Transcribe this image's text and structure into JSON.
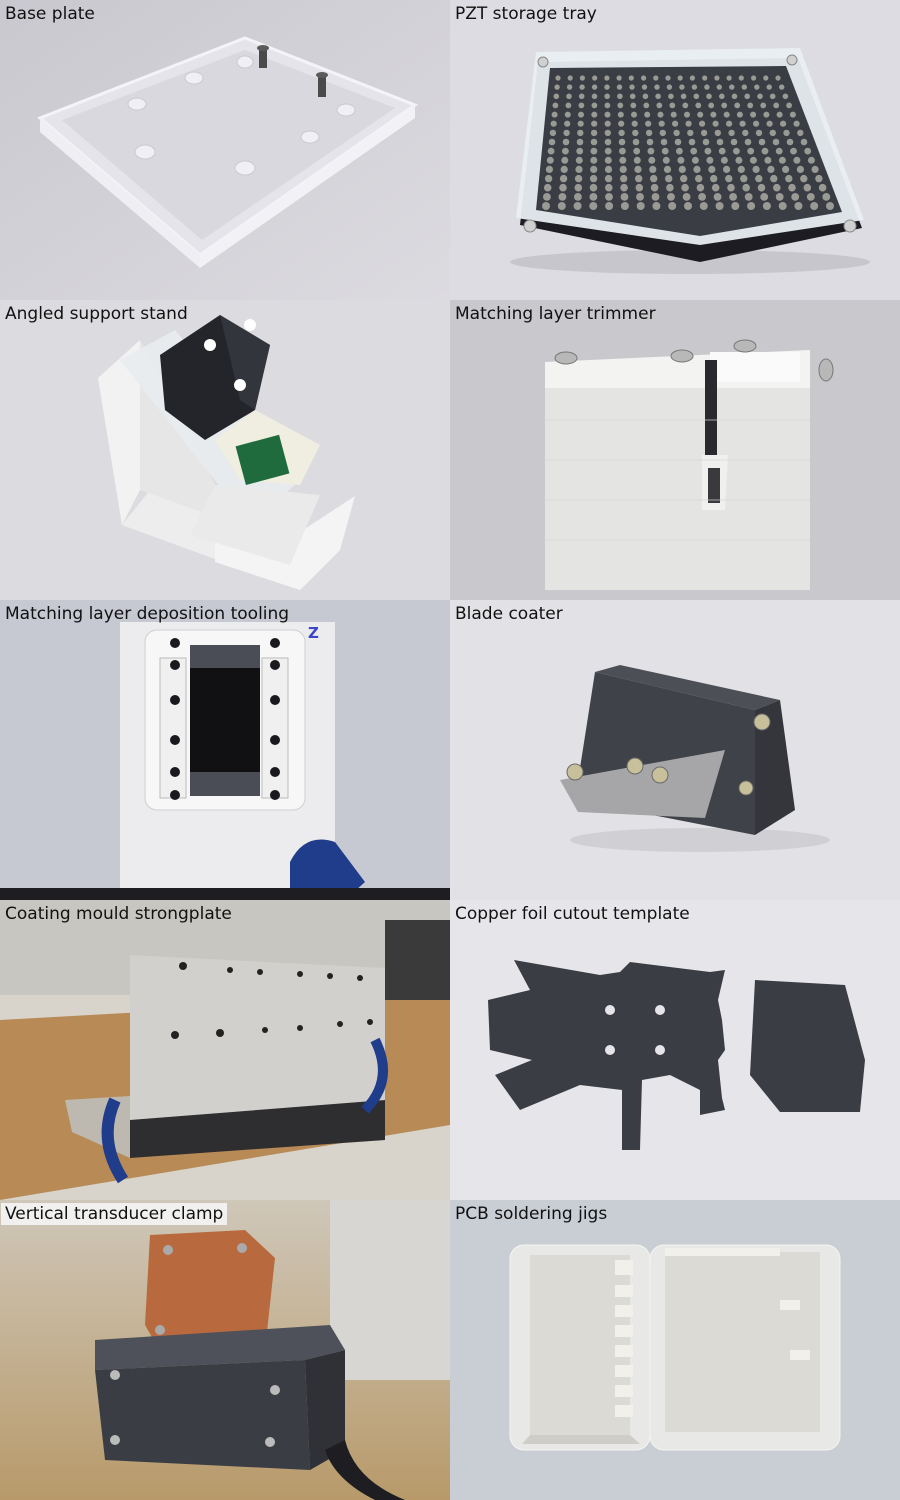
{
  "panels": [
    {
      "id": "base-plate",
      "caption": "Base plate"
    },
    {
      "id": "pzt-storage-tray",
      "caption": "PZT storage tray"
    },
    {
      "id": "angled-support-stand",
      "caption": "Angled support stand"
    },
    {
      "id": "matching-layer-trimmer",
      "caption": "Matching layer trimmer"
    },
    {
      "id": "matching-layer-deposition-tooling",
      "caption": "Matching layer deposition tooling"
    },
    {
      "id": "blade-coater",
      "caption": "Blade coater"
    },
    {
      "id": "coating-mould-strongplate",
      "caption": "Coating mould strongplate"
    },
    {
      "id": "copper-foil-cutout-template",
      "caption": "Copper foil cutout template"
    },
    {
      "id": "vertical-transducer-clamp",
      "caption": "Vertical transducer clamp"
    },
    {
      "id": "pcb-soldering-jigs",
      "caption": "PCB soldering jigs"
    }
  ],
  "deposition_mark": "Z"
}
